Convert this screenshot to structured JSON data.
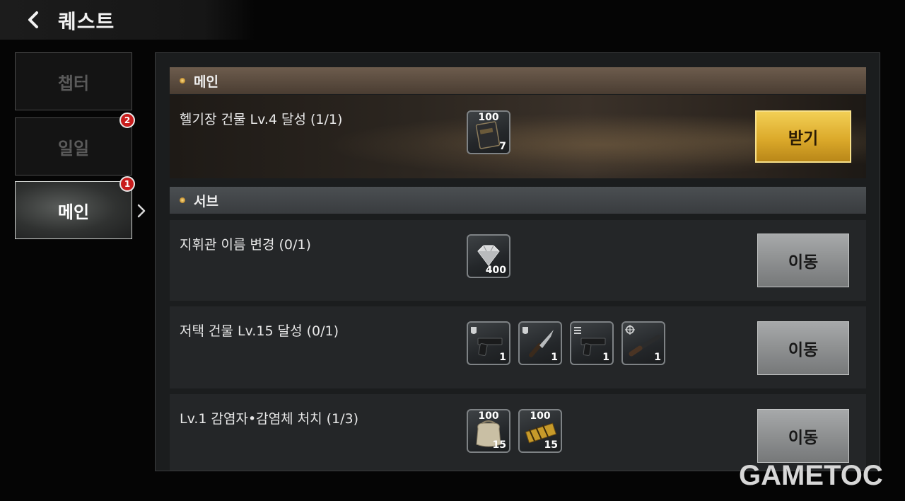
{
  "header": {
    "title": "퀘스트"
  },
  "sidebar": {
    "tabs": [
      {
        "label": "챕터",
        "badge": ""
      },
      {
        "label": "일일",
        "badge": "2"
      },
      {
        "label": "메인",
        "badge": "1"
      }
    ]
  },
  "sections": {
    "main": {
      "label": "메인"
    },
    "sub": {
      "label": "서브"
    }
  },
  "quests": [
    {
      "title": "헬기장 건물 Lv.4 달성 (1/1)",
      "button": "받기",
      "rewards": [
        {
          "icon": "manual-book-icon",
          "top": "100",
          "qty": "7"
        }
      ]
    },
    {
      "title": "지휘관 이름 변경 (0/1)",
      "button": "이동",
      "rewards": [
        {
          "icon": "diamond-icon",
          "top": "",
          "qty": "400"
        }
      ]
    },
    {
      "title": "저택 건물 Lv.15 달성 (0/1)",
      "button": "이동",
      "rewards": [
        {
          "icon": "pistol-icon",
          "top": "",
          "qty": "1"
        },
        {
          "icon": "knife-icon",
          "top": "",
          "qty": "1"
        },
        {
          "icon": "smg-icon",
          "top": "",
          "qty": "1"
        },
        {
          "icon": "rifle-icon",
          "top": "",
          "qty": "1"
        }
      ]
    },
    {
      "title": "Lv.1 감염자•감염체 처치 (1/3)",
      "button": "이동",
      "rewards": [
        {
          "icon": "supply-sack-icon",
          "top": "100",
          "qty": "15"
        },
        {
          "icon": "ammo-belt-icon",
          "top": "100",
          "qty": "15"
        }
      ]
    }
  ],
  "watermark": "GAMETOC",
  "colors": {
    "claim": "#dcaa2b",
    "move": "#8e9091",
    "badge": "#c81d1d",
    "main_header": "#5a4a3d",
    "sub_header": "#424649"
  }
}
